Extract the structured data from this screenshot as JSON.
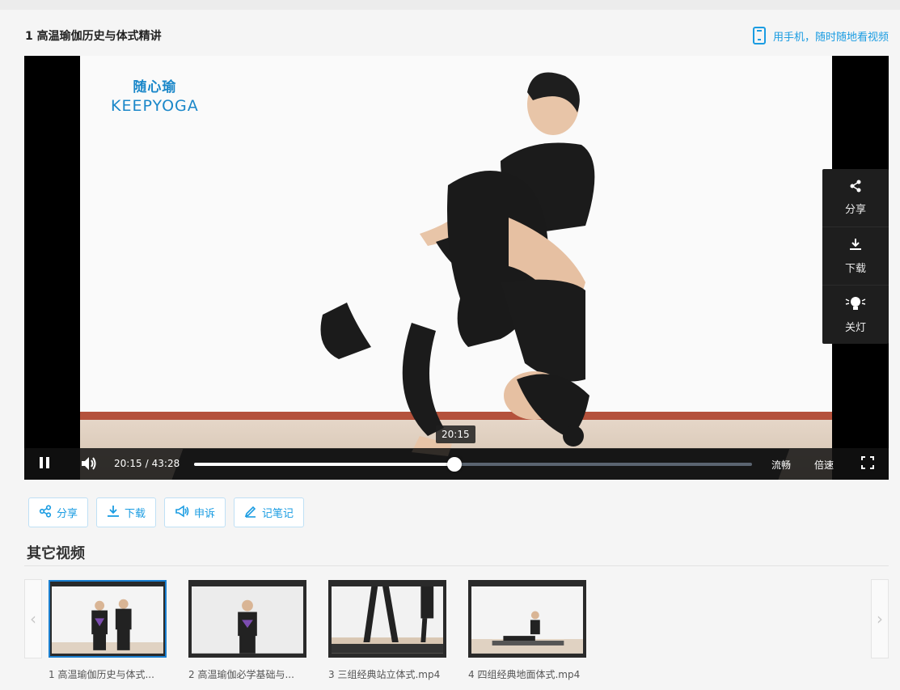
{
  "header": {
    "title": "1 高温瑜伽历史与体式精讲",
    "mobile_link": "用手机，随时随地看视频"
  },
  "player": {
    "brand_cn": "随心瑜",
    "brand_en": "KEEPYOGA",
    "side_menu": [
      {
        "label": "分享",
        "icon": "share-icon"
      },
      {
        "label": "下载",
        "icon": "download-icon"
      },
      {
        "label": "关灯",
        "icon": "light-off-icon"
      }
    ],
    "current_time": "20:15",
    "duration": "43:28",
    "progress_fraction": 0.466,
    "hover_time": "20:15",
    "quality": "流畅",
    "speed": "倍速"
  },
  "actions": [
    {
      "label": "分享",
      "icon": "share-icon"
    },
    {
      "label": "下载",
      "icon": "download-icon"
    },
    {
      "label": "申诉",
      "icon": "megaphone-icon"
    },
    {
      "label": "记笔记",
      "icon": "pencil-icon"
    }
  ],
  "other_videos": {
    "title": "其它视频",
    "items": [
      {
        "caption": "1 高温瑜伽历史与体式...",
        "active": true
      },
      {
        "caption": "2 高温瑜伽必学基础与...",
        "active": false
      },
      {
        "caption": "3 三组经典站立体式.mp4",
        "active": false
      },
      {
        "caption": "4 四组经典地面体式.mp4",
        "active": false
      }
    ]
  },
  "colors": {
    "accent": "#1a9ce2",
    "active_border": "#1a7fd0"
  }
}
